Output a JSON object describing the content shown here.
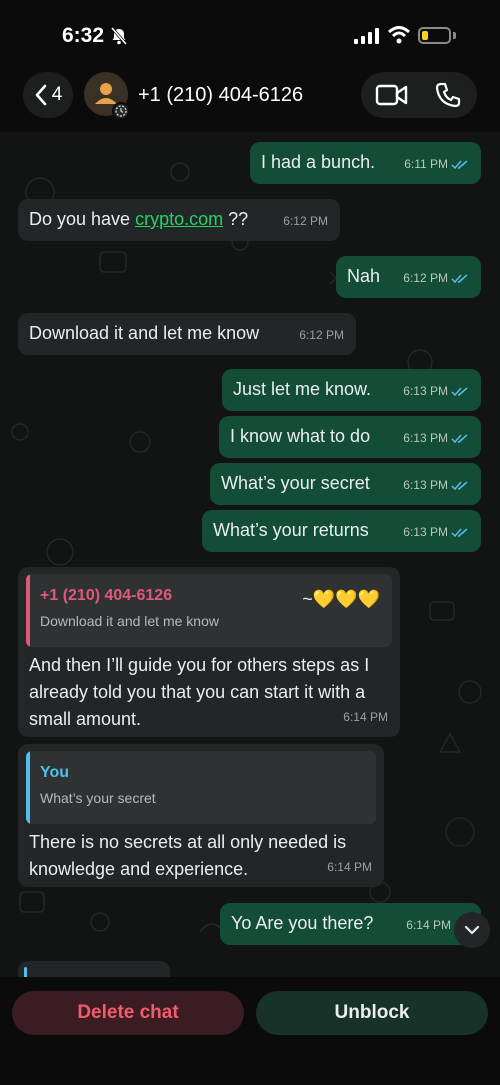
{
  "status": {
    "time": "6:32",
    "battery_level": 0.25
  },
  "header": {
    "back_count": "4",
    "contact": "+1 (210) 404-6126"
  },
  "messages": [
    {
      "dir": "out",
      "text": "I had a bunch.",
      "time": "6:11 PM"
    },
    {
      "dir": "in",
      "text_pre": "Do you have ",
      "link": "crypto.com",
      "text_post": " ??",
      "time": "6:12 PM"
    },
    {
      "dir": "out",
      "text": "Nah",
      "time": "6:12 PM"
    },
    {
      "dir": "in",
      "text": "Download it and let me know",
      "time": "6:12 PM"
    },
    {
      "dir": "out",
      "text": "Just let me know.",
      "time": "6:13 PM"
    },
    {
      "dir": "out",
      "text": "I know what to do",
      "time": "6:13 PM"
    },
    {
      "dir": "out",
      "text": "What’s your secret",
      "time": "6:13 PM"
    },
    {
      "dir": "out",
      "text": "What’s your returns",
      "time": "6:13 PM"
    },
    {
      "dir": "in",
      "quote_name": "+1 (210) 404-6126",
      "quote_text": "Download it and let me know",
      "reaction": "~💛💛💛",
      "text": "And then I’ll guide you for others steps as I already told you that you can start it with a small amount.",
      "time": "6:14 PM"
    },
    {
      "dir": "in",
      "quote_name": "You",
      "quote_text": "What’s your secret",
      "text": "There is no secrets at all only needed is knowledge and experience.",
      "time": "6:14 PM"
    },
    {
      "dir": "out",
      "text": "Yo Are you there?",
      "time": "6:14 PM"
    }
  ],
  "actions": {
    "delete": "Delete chat",
    "unblock": "Unblock"
  },
  "colors": {
    "outgoing": "#144d37",
    "incoming": "#232626",
    "quote_in": "#e2587a",
    "quote_you": "#53bdeb",
    "read_ticks": "#53bdeb"
  }
}
